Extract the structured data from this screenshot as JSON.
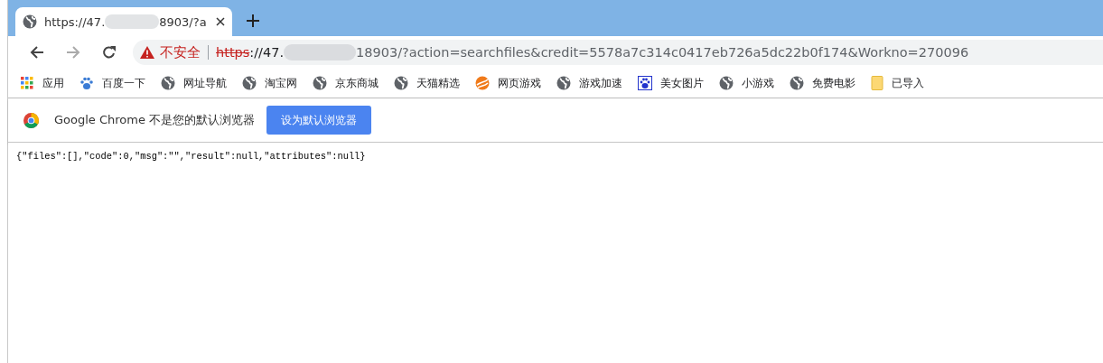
{
  "tabs": [
    {
      "title_start": "https://47.",
      "title_end": "8903/?a",
      "selected": true
    }
  ],
  "toolbar": {
    "security_label": "不安全",
    "url_scheme": "https",
    "url_host_start": "://47.",
    "url_rest": "18903/?action=searchfiles&credit=5578a7c314c0417eb726a5dc22b0f174&Workno=270096"
  },
  "bookmarks": [
    {
      "label": "应用",
      "kind": "apps"
    },
    {
      "label": "百度一下",
      "kind": "paw"
    },
    {
      "label": "网址导航",
      "kind": "globe"
    },
    {
      "label": "淘宝网",
      "kind": "globe"
    },
    {
      "label": "京东商城",
      "kind": "globe"
    },
    {
      "label": "天猫精选",
      "kind": "globe"
    },
    {
      "label": "网页游戏",
      "kind": "game"
    },
    {
      "label": "游戏加速",
      "kind": "globe"
    },
    {
      "label": "美女图片",
      "kind": "pawbox"
    },
    {
      "label": "小游戏",
      "kind": "globe"
    },
    {
      "label": "免费电影",
      "kind": "globe"
    },
    {
      "label": "已导入",
      "kind": "folder"
    }
  ],
  "infobar": {
    "message": "Google Chrome 不是您的默认浏览器",
    "button": "设为默认浏览器"
  },
  "page": {
    "body": "{\"files\":[],\"code\":0,\"msg\":\"\",\"result\":null,\"attributes\":null}"
  }
}
